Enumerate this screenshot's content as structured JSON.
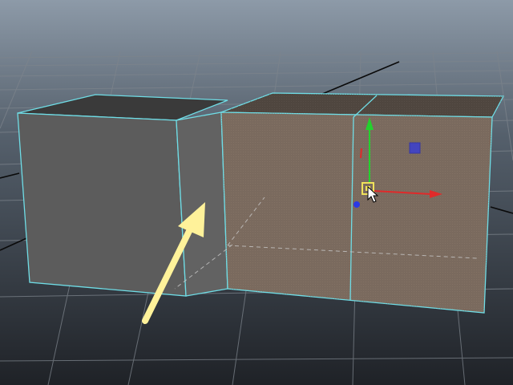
{
  "viewport": {
    "background_top": "#8d9aa8",
    "background_bottom": "#1f2227",
    "grid_color": "#7d848c",
    "axis_color": "#0a0a0a",
    "wireframe_color": "#6fdde6",
    "object_face": "#5c5c5c",
    "object_side": "#626262",
    "object_top": "#3a3a3a",
    "selected_face": "#7a6a5e",
    "selected_top": "#4f463f",
    "annotation_arrow_color": "#fff29a"
  },
  "manipulator": {
    "x_axis_color": "#e02a2a",
    "y_axis_color": "#23d12d",
    "z_axis_color": "#2a39e6",
    "center_color": "#f0e25a",
    "plane_handle_color": "#3a3fd0",
    "icons": [
      "move-tool-icon",
      "mouse-cursor-icon"
    ]
  }
}
